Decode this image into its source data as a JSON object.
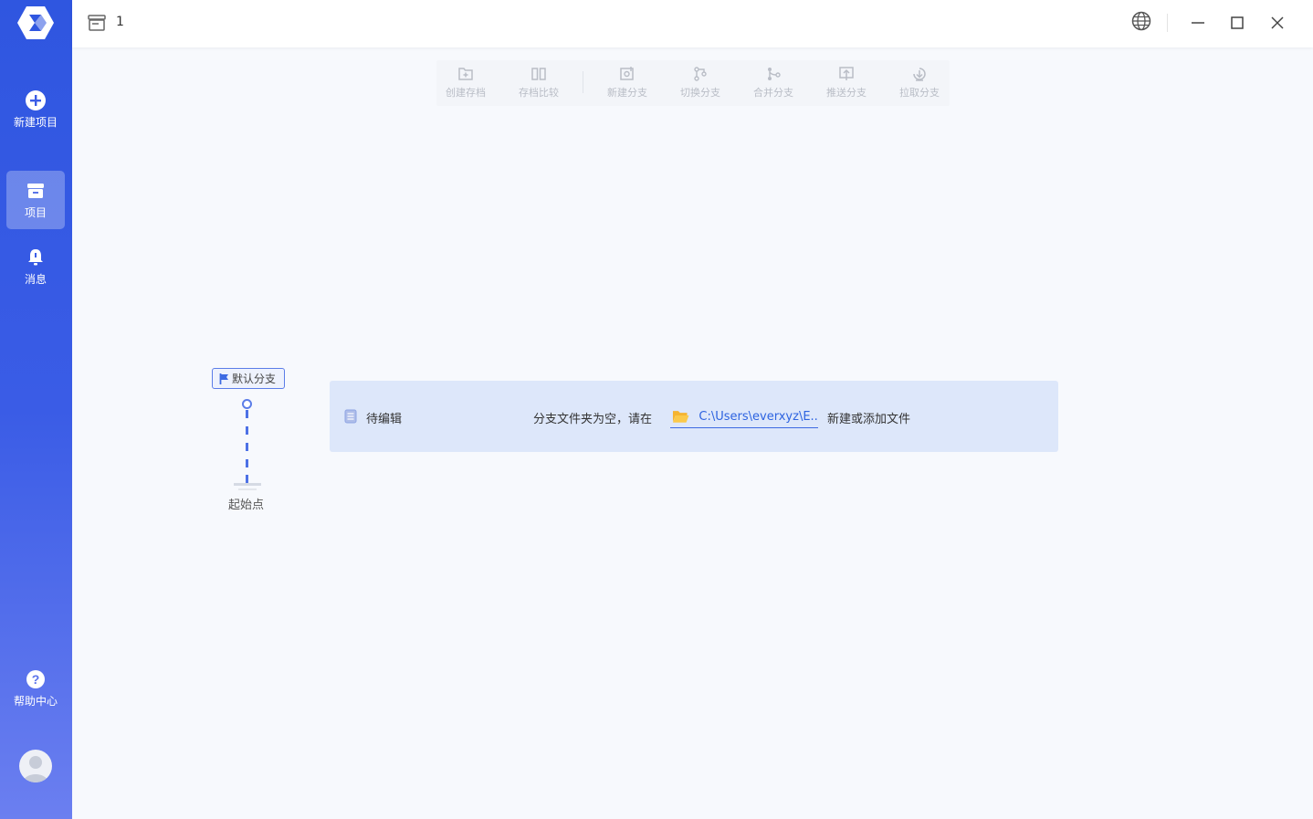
{
  "sidebar": {
    "items": [
      {
        "label": "新建项目"
      },
      {
        "label": "项目"
      },
      {
        "label": "消息"
      },
      {
        "label": "帮助中心"
      }
    ]
  },
  "titlebar": {
    "project_name": "1"
  },
  "toolbar": {
    "buttons": [
      {
        "label": "创建存档"
      },
      {
        "label": "存档比较"
      },
      {
        "label": "新建分支"
      },
      {
        "label": "切换分支"
      },
      {
        "label": "合并分支"
      },
      {
        "label": "推送分支"
      },
      {
        "label": "拉取分支"
      }
    ]
  },
  "branch": {
    "tag_label": "默认分支",
    "start_label": "起始点"
  },
  "pending": {
    "title": "待编辑",
    "empty_message": "分支文件夹为空，请在",
    "folder_path": "C:\\Users\\everxyz\\E...",
    "add_message": "新建或添加文件"
  },
  "colors": {
    "sidebar_top": "#2f56e0",
    "sidebar_bottom": "#6b7ff0",
    "accent": "#3d6ae2",
    "card_bg": "#dde7fa"
  }
}
